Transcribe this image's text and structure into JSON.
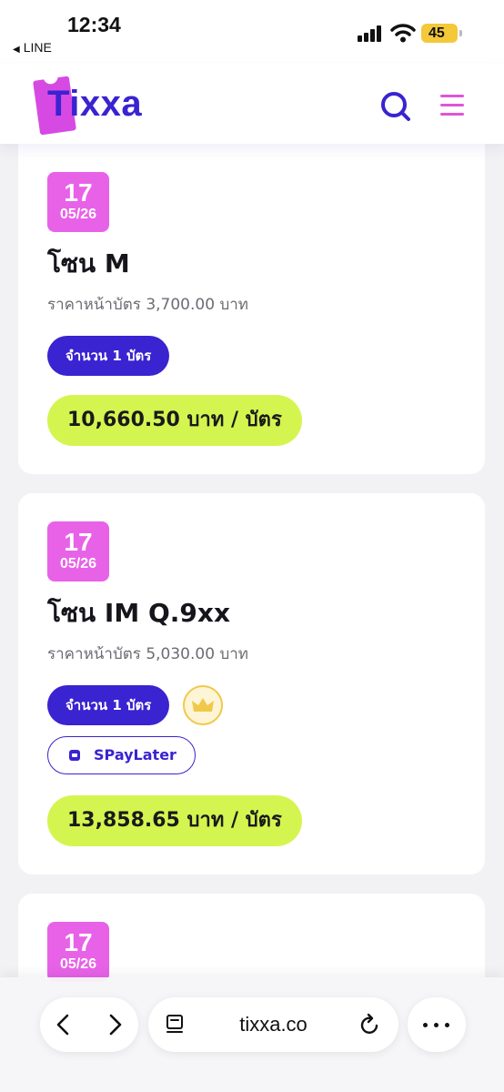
{
  "status_bar": {
    "time": "12:34",
    "back_app": "LINE",
    "battery": "45",
    "battery_color": "#f3c93a"
  },
  "header": {
    "logo_text": "Tixxa",
    "icons": [
      "search-icon",
      "menu-icon"
    ],
    "brand_color": "#3a23d0",
    "accent_color": "#e055d6"
  },
  "tickets": [
    {
      "day": "17",
      "month": "05/26",
      "zone": "โซน M",
      "face_price": "ราคาหน้าบัตร 3,700.00 บาท",
      "quantity": "จำนวน 1 บัตร",
      "total": "10,660.50 บาท / บัตร"
    },
    {
      "day": "17",
      "month": "05/26",
      "zone": "โซน IM Q.9xx",
      "face_price": "ราคาหน้าบัตร 5,030.00 บาท",
      "quantity": "จำนวน 1 บัตร",
      "badge_icon": "crown-icon",
      "payment_option": "SPayLater",
      "total": "13,858.65 บาท / บัตร"
    },
    {
      "day": "17",
      "month": "05/26"
    }
  ],
  "browser": {
    "url": "tixxa.co",
    "icons": [
      "back-icon",
      "forward-icon",
      "tabs-icon",
      "reload-icon",
      "more-icon"
    ]
  }
}
